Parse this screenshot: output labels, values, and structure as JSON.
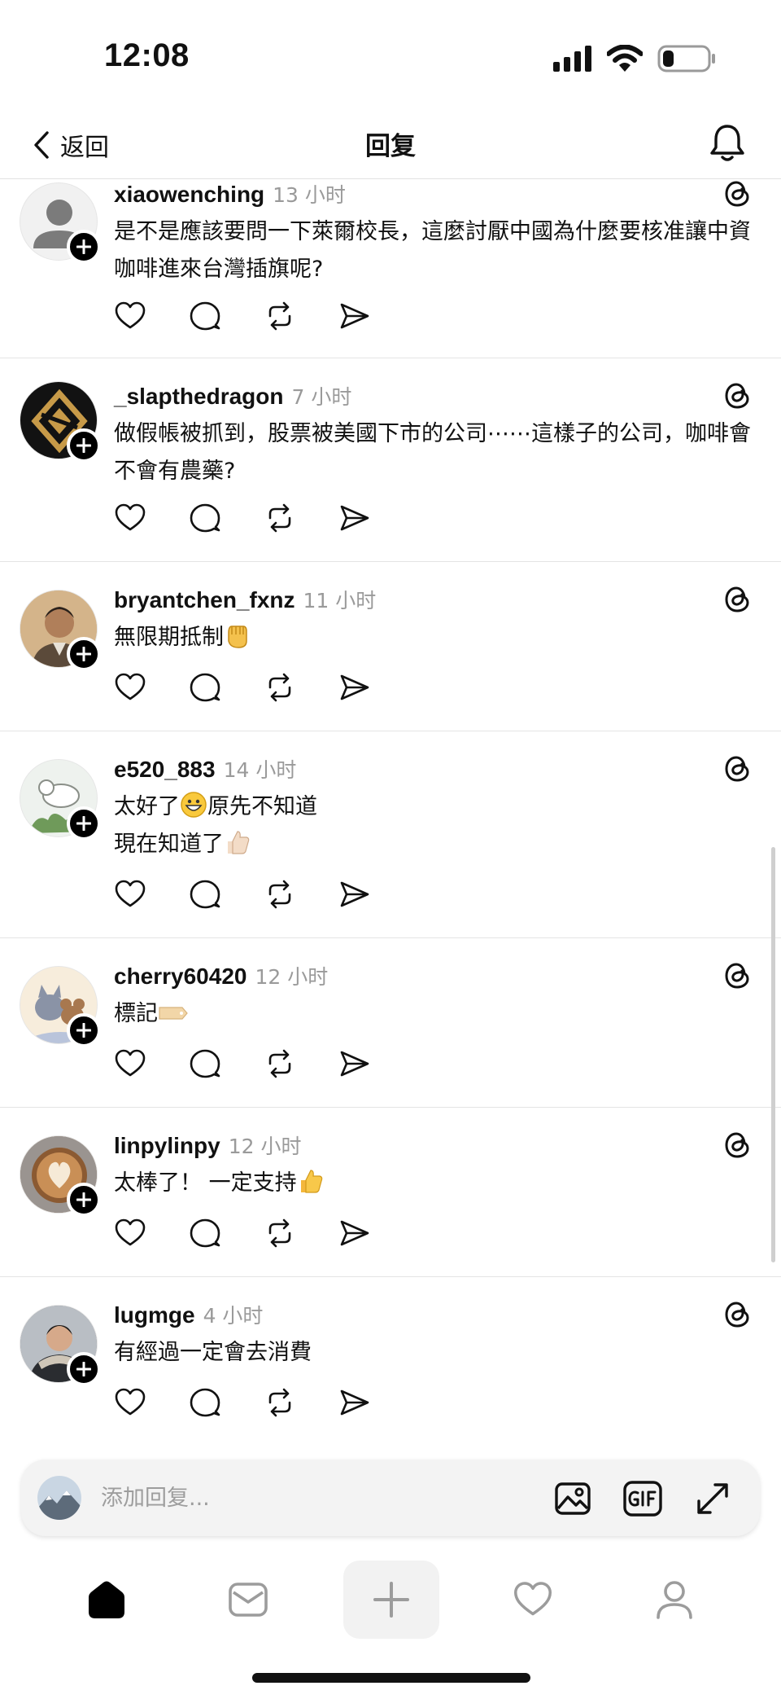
{
  "status_bar": {
    "time": "12:08",
    "icons": [
      "signal-icon",
      "wifi-icon",
      "battery-icon"
    ],
    "battery_level": 0.25
  },
  "header": {
    "back_label": "返回",
    "title": "回复",
    "bell_icon": "bell-icon"
  },
  "replies": [
    {
      "username": "xiaowenching",
      "time": "13 小时",
      "text": "是不是應該要問一下萊爾校長，這麼討厭中國為什麼要核准讓中資咖啡進來台灣插旗呢?",
      "avatar": "default-avatar"
    },
    {
      "username": "_slapthedragon",
      "time": "7 小时",
      "text": "做假帳被抓到，股票被美國下市的公司⋯⋯這樣子的公司，咖啡會不會有農藥?",
      "avatar": "gold-diamond-logo"
    },
    {
      "username": "bryantchen_fxnz",
      "time": "11 小时",
      "text": "無限期抵制",
      "emoji": "raised-fist-emoji",
      "avatar": "man-portrait"
    },
    {
      "username": "e520_883",
      "time": "14 小时",
      "text_line1": "太好了",
      "text_line1_after": "原先不知道",
      "text_line2": "現在知道了",
      "emoji1": "grinning-face-emoji",
      "emoji2": "thumbs-up-light-emoji",
      "avatar": "cat-illustration"
    },
    {
      "username": "cherry60420",
      "time": "12 小时",
      "text": "標記",
      "emoji": "label-tag-emoji",
      "avatar": "cartoon-cat-mouse"
    },
    {
      "username": "linpylinpy",
      "time": "12 小时",
      "text": "太棒了！ 一定支持",
      "emoji": "thumbs-up-emoji",
      "avatar": "latte-art"
    },
    {
      "username": "lugmge",
      "time": "4 小时",
      "text": "有經過一定會去消費",
      "avatar": "man-in-jacket"
    }
  ],
  "action_icons": [
    "heart-icon",
    "comment-icon",
    "repost-icon",
    "share-icon"
  ],
  "composer": {
    "placeholder": "添加回复...",
    "buttons": [
      "image-icon",
      "gif-icon",
      "expand-icon"
    ]
  },
  "tabbar": {
    "items": [
      "home-icon",
      "inbox-icon",
      "plus-icon",
      "heart-icon",
      "profile-icon"
    ]
  }
}
